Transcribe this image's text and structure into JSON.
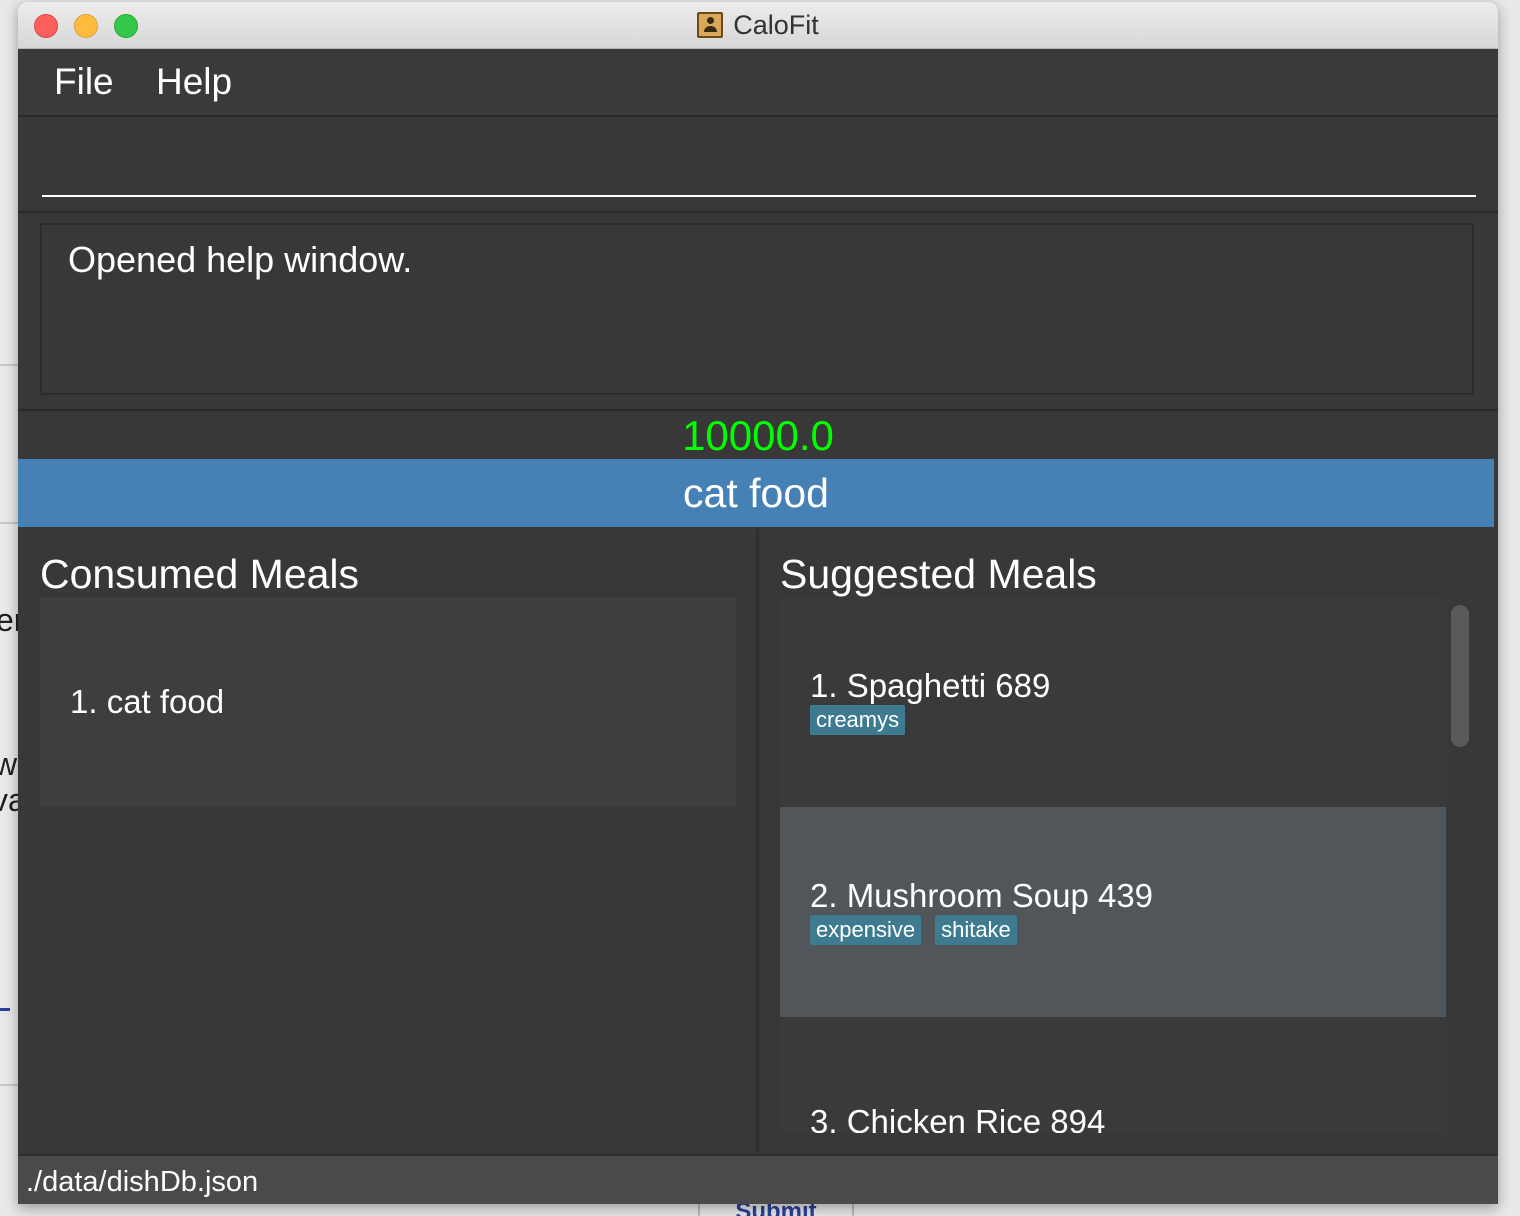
{
  "window": {
    "title": "CaloFit"
  },
  "menu": {
    "file": "File",
    "help": "Help"
  },
  "command": {
    "value": "",
    "placeholder": ""
  },
  "result": {
    "message": "Opened help window."
  },
  "calorie_budget": "10000.0",
  "current_meal": "cat food",
  "consumed": {
    "title": "Consumed Meals",
    "items": [
      {
        "label": "1.  cat food"
      }
    ]
  },
  "suggested": {
    "title": "Suggested Meals",
    "items": [
      {
        "label": "1.  Spaghetti 689",
        "tags": [
          "creamys"
        ]
      },
      {
        "label": "2.  Mushroom Soup 439",
        "tags": [
          "expensive",
          "shitake"
        ]
      },
      {
        "label": "3.  Chicken Rice 894",
        "tags": []
      }
    ]
  },
  "status": {
    "path": "./data/dishDb.json"
  },
  "background": {
    "submit_label": "Submit"
  }
}
